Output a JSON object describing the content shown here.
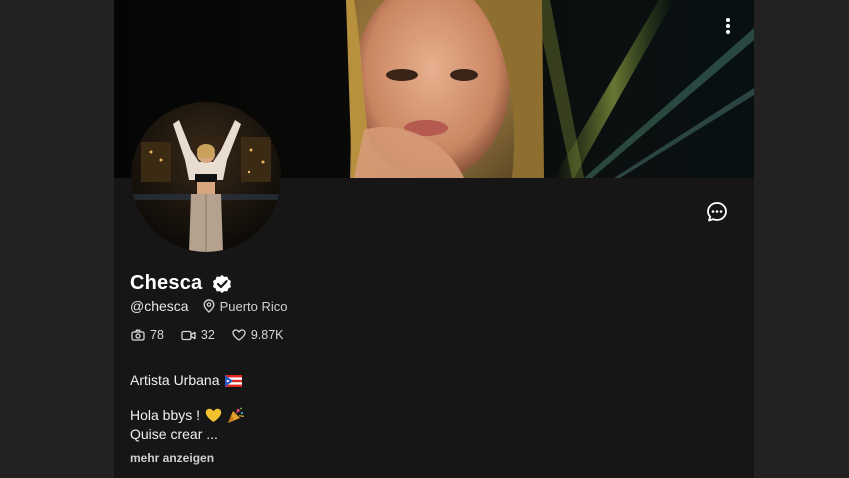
{
  "profile": {
    "name": "Chesca",
    "handle": "@chesca",
    "location": "Puerto Rico",
    "verified": true
  },
  "stats": {
    "photos": "78",
    "videos": "32",
    "likes": "9.87K"
  },
  "bio": {
    "tagline": "Artista Urbana",
    "greeting": "Hola bbys !",
    "line2": "Quise crear ...",
    "show_more_label": "mehr anzeigen"
  },
  "icons": {
    "menu": "more-vertical-icon",
    "message": "chat-bubble-icon",
    "verified": "verified-check-icon",
    "location": "map-pin-icon",
    "photos": "camera-icon",
    "videos": "video-icon",
    "likes": "heart-icon",
    "flag": "puerto-rico-flag-icon",
    "heart_emoji": "yellow-heart-icon",
    "party": "party-popper-icon"
  },
  "colors": {
    "page_background": "#222222",
    "card_background": "#161616",
    "text_primary": "#ffffff",
    "text_secondary": "#d0d0d0"
  }
}
